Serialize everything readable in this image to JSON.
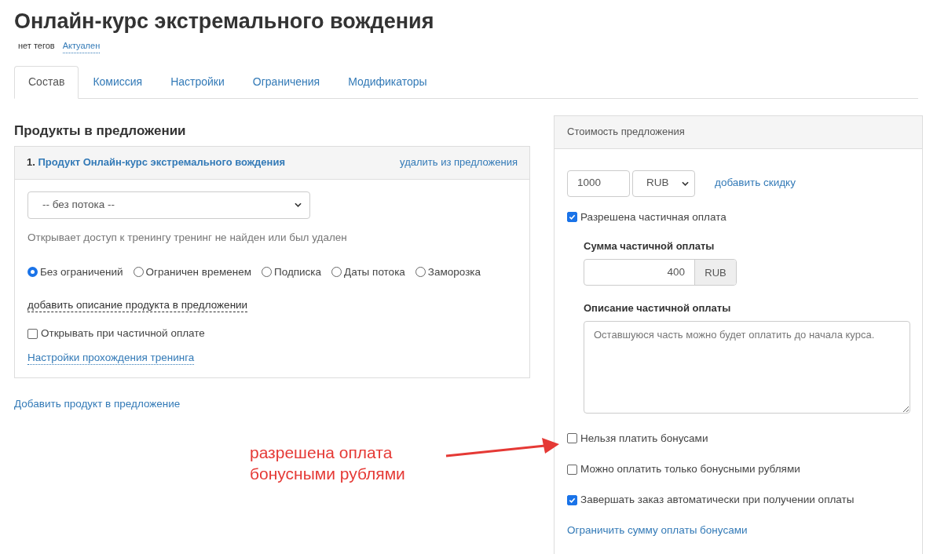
{
  "title": "Онлайн-курс экстремального вождения",
  "meta": {
    "tags": "нет тегов",
    "status": "Актуален"
  },
  "tabs": [
    {
      "label": "Состав",
      "selected": true
    },
    {
      "label": "Комиссия",
      "selected": false
    },
    {
      "label": "Настройки",
      "selected": false
    },
    {
      "label": "Ограничения",
      "selected": false
    },
    {
      "label": "Модификаторы",
      "selected": false
    }
  ],
  "products": {
    "heading": "Продукты в предложении",
    "items": [
      {
        "number": "1.",
        "name": "Продукт Онлайн-курс экстремального вождения",
        "remove": "удалить из предложения",
        "stream": "-- без потока --",
        "access_note": "Открывает доступ к тренингу тренинг не найден или был удален",
        "access_options": [
          {
            "label": "Без ограничений",
            "selected": true
          },
          {
            "label": "Ограничен временем",
            "selected": false
          },
          {
            "label": "Подписка",
            "selected": false
          },
          {
            "label": "Даты потока",
            "selected": false
          },
          {
            "label": "Заморозка",
            "selected": false
          }
        ],
        "add_description": "добавить описание продукта в предложении",
        "open_on_partial": {
          "label": "Открывать при частичной оплате",
          "checked": false
        },
        "training_settings": "Настройки прохождения тренинга"
      }
    ],
    "add_product": "Добавить продукт в предложение"
  },
  "price": {
    "heading": "Стоимость предложения",
    "amount": "1000",
    "currency": "RUB",
    "add_discount": "добавить скидку",
    "partial": {
      "label": "Разрешена частичная оплата",
      "checked": true
    },
    "partial_sum": {
      "label": "Сумма частичной оплаты",
      "value": "400",
      "unit": "RUB"
    },
    "partial_description": {
      "label": "Описание частичной оплаты",
      "placeholder": "Оставшуюся часть можно будет оплатить до начала курса."
    },
    "options": [
      {
        "label": "Нельзя платить бонусами",
        "checked": false
      },
      {
        "label": "Можно оплатить только бонусными рублями",
        "checked": false
      },
      {
        "label": "Завершать заказ автоматически при получении оплаты",
        "checked": true
      }
    ],
    "limit_bonus": "Ограничить сумму оплаты бонусами"
  },
  "annotation": {
    "text": "разрешена оплата бонусными рублями"
  }
}
